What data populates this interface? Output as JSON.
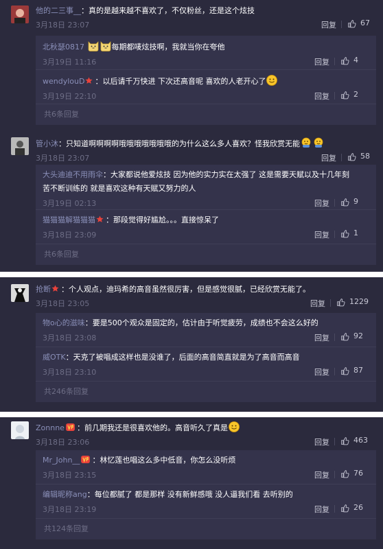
{
  "blocks": [
    {
      "comment": {
        "user": "他的二三事__",
        "text": "：真的是越来越不喜欢了，不仅粉丝，还是这个炫技",
        "time": "3月18日 23:07",
        "reply_label": "回复",
        "likes": "67"
      },
      "replies": [
        {
          "user": "北秋瑟0817",
          "text_after_emoji": "每期都唛炫技啊，我就当你在夸他",
          "time": "3月19日 11:16",
          "reply_label": "回复",
          "likes": "4"
        },
        {
          "user": "wendylouD",
          "text": "：以后请千万快进 下次还高音呢 喜欢的人老开心了",
          "time": "3月19日 22:10",
          "reply_label": "回复",
          "likes": "2"
        }
      ],
      "more": "共6条回复"
    },
    {
      "comment": {
        "user": "管小沐",
        "text": "：只知道啊啊啊啊哦哦哦哦哦哦哦的为什么这么多人喜欢？怪我欣赏无能",
        "time": "3月18日 23:07",
        "reply_label": "回复",
        "likes": "58"
      },
      "replies": [
        {
          "user": "大头迪迪不用雨伞",
          "text": "：大家都说他爱炫技 因为他的实力实在太强了 这是需要天赋以及十几年刻",
          "text2": "苦不断训练的 就是喜欢这种有天赋又努力的人",
          "time": "3月19日 02:13",
          "reply_label": "回复",
          "likes": "9"
        },
        {
          "user": "猫猫猫解猫猫猫",
          "text": "：那段觉得好尴尬。。。直接惊呆了",
          "time": "3月18日 23:09",
          "reply_label": "回复",
          "likes": "1"
        }
      ],
      "more": "共6条回复"
    },
    {
      "comment": {
        "user": "抢断",
        "text": "：个人观点，迪玛希的高音虽然很厉害，但是感觉很腻，已经欣赏无能了。",
        "time": "3月18日 23:05",
        "reply_label": "回复",
        "likes": "1229"
      },
      "replies": [
        {
          "user": "物o心的滋味",
          "text": "：要是500个观众是固定的，估计由于听觉疲劳，成绩也不会这么好的",
          "time": "3月18日 23:08",
          "reply_label": "回复",
          "likes": "92"
        },
        {
          "user": "威OTK",
          "text": "：天克了被唱成这样也是没谁了，后面的高音简直就是为了高音而高音",
          "time": "3月18日 23:10",
          "reply_label": "回复",
          "likes": "87"
        }
      ],
      "more": "共246条回复"
    },
    {
      "comment": {
        "user": "Zonnne",
        "text": "：前几期我还是很喜欢他的。高音听久了真是",
        "time": "3月18日 23:06",
        "reply_label": "回复",
        "likes": "463"
      },
      "replies": [
        {
          "user": "Mr_John__",
          "text": "：林忆莲也唱这么多中低音，你怎么没听烦",
          "time": "3月18日 23:15",
          "reply_label": "回复",
          "likes": "76"
        },
        {
          "user": "编辑昵称ang",
          "text": "：每位都腻了 都是那样 没有新鲜感哦 没人逼我们看  去听别的",
          "time": "3月18日 23:19",
          "reply_label": "回复",
          "likes": "26"
        }
      ],
      "more": "共124条回复"
    }
  ],
  "colors": {
    "background": "#2b2a3d",
    "reply_background": "#34334b",
    "username": "#8a8fb8",
    "comment_text": "#ffffff",
    "timestamp": "#6e6e86",
    "badge_red": "#e8423b"
  },
  "icons": [
    "thumbs-up-icon",
    "star-badge-icon",
    "vip-badge-icon",
    "smile-emoji-icon",
    "cat-emoji-icon"
  ]
}
